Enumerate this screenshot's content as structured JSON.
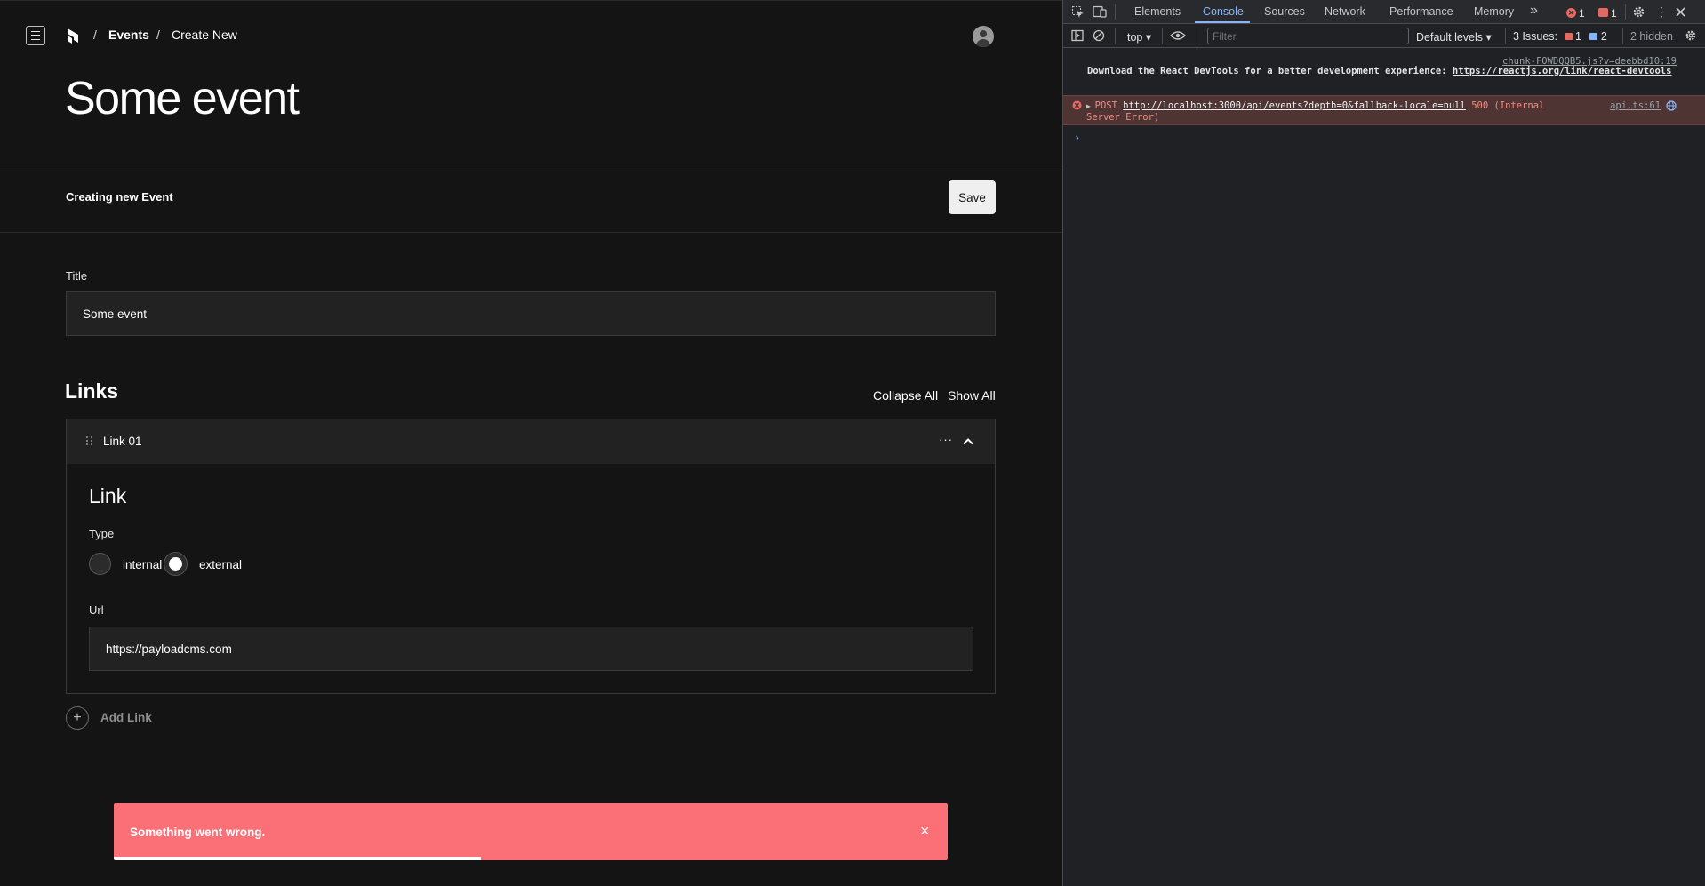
{
  "breadcrumb": {
    "separator": "/",
    "items": [
      "Events",
      "Create New"
    ]
  },
  "page": {
    "title": "Some event",
    "status_text": "Creating new Event",
    "save_label": "Save"
  },
  "fields": {
    "title": {
      "label": "Title",
      "value": "Some event"
    }
  },
  "links": {
    "heading": "Links",
    "collapse_all": "Collapse All",
    "show_all": "Show All",
    "rows": [
      {
        "label": "Link 01",
        "more": "···",
        "group_heading": "Link",
        "type_label": "Type",
        "type_options": [
          "internal",
          "external"
        ],
        "type_selected": "external",
        "url_label": "Url",
        "url_value": "https://payloadcms.com"
      }
    ],
    "add_label": "Add Link"
  },
  "toast": {
    "message": "Something went wrong.",
    "close": "×",
    "progress": 0.44,
    "color": "#fb6f77"
  },
  "devtools": {
    "tabs": [
      "Elements",
      "Console",
      "Sources",
      "Network",
      "Performance",
      "Memory"
    ],
    "active_tab": "Console",
    "overflow": "»",
    "error_count": "1",
    "warning_count": "1",
    "context": "top",
    "filter_placeholder": "Filter",
    "levels": "Default levels",
    "issues_label": "3 Issues:",
    "issues_errors": "1",
    "issues_info": "2",
    "hidden": "2 hidden",
    "messages": [
      {
        "source": "chunk-FOWDQQB5.js?v=deebbd10:19",
        "text": "Download the React DevTools for a better development experience: ",
        "link": "https://reactjs.org/link/react-devtools"
      },
      {
        "method": "POST",
        "url": "http://localhost:3000/api/events?depth=0&fallback-locale=null",
        "status": "500 (Internal Server Error)",
        "source": "api.ts:61"
      }
    ],
    "prompt": "›"
  },
  "colors": {
    "accent": "#8ab4f8",
    "error": "#e46962",
    "background": "#141414"
  }
}
